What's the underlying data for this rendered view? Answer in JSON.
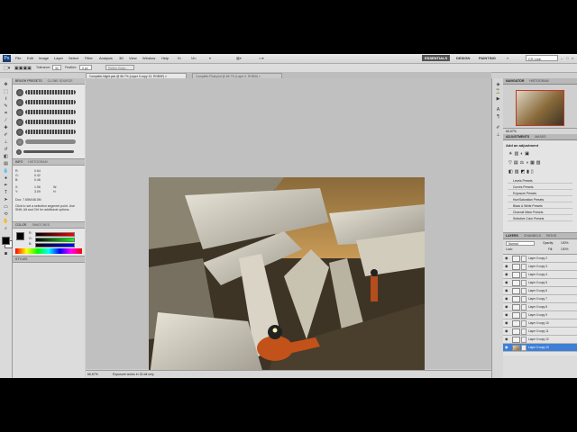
{
  "app": {
    "logo": "Ps"
  },
  "menubar": {
    "items": [
      "File",
      "Edit",
      "Image",
      "Layer",
      "Select",
      "Filter",
      "Analysis",
      "3D",
      "View",
      "Window",
      "Help"
    ],
    "workspaces": [
      "ESSENTIALS",
      "DESIGN",
      "PAINTING"
    ],
    "more": "»",
    "search_placeholder": "CS Live"
  },
  "options": {
    "tolerance_label": "Tolerance:",
    "tolerance_value": "32",
    "feather_label": "Feather:",
    "feather_value": "0 px",
    "refine_label": "Refine Edge..."
  },
  "tabs": [
    {
      "label": "Complete-Night.psd @ 66.7% (Layer 0 copy 13, RGB/8*) ×",
      "active": true
    },
    {
      "label": "Complete-Final.psd @ 66.7% (Layer 0, RGB/8) ×",
      "active": false
    }
  ],
  "brushes_panel": {
    "tab1": "BRUSH PRESETS",
    "tab2": "CLONE SOURCE",
    "info_tab": "INFO",
    "navigator_tab": "HISTOGRAM",
    "r_label": "R:",
    "g_label": "G:",
    "b_label": "B:",
    "x_label": "X:",
    "y_label": "Y:",
    "w_label": "W:",
    "h_label": "H:",
    "r_val": "0.64",
    "g_val": "0.42",
    "b_val": "0.46",
    "x_val": "1.96",
    "y_val": "3.09",
    "doc_info": "Doc: 7.65M/48.0M",
    "hint": "Click to set a selection segment point. Use Shift, Alt and Ctrl for additional options.",
    "color_tab": "COLOR",
    "swatches_tab": "SWATCHES",
    "styles_tab": "STYLES"
  },
  "status": {
    "zoom": "66.67%",
    "info": "Exposure works in 32-bit only"
  },
  "navigator": {
    "tab": "NAVIGATOR",
    "histogram": "HISTOGRAM",
    "zoom": "66.67%"
  },
  "adjustments": {
    "tab": "ADJUSTMENTS",
    "masks": "MASKS",
    "title": "Add an adjustment",
    "presets": [
      "Levels Presets",
      "Curves Presets",
      "Exposure Presets",
      "Hue/Saturation Presets",
      "Black & White Presets",
      "Channel Mixer Presets",
      "Selective Color Presets"
    ]
  },
  "layers": {
    "tab": "LAYERS",
    "channels": "CHANNELS",
    "paths": "PATHS",
    "blend_mode": "Normal",
    "opacity_label": "Opacity:",
    "opacity_value": "100%",
    "lock_label": "Lock:",
    "fill_label": "Fill:",
    "fill_value": "100%",
    "items": [
      "Layer 0 copy 2",
      "Layer 0 copy 3",
      "Layer 0 copy 4",
      "Layer 0 copy 5",
      "Layer 0 copy 6",
      "Layer 0 copy 7",
      "Layer 0 copy 8",
      "Layer 0 copy 9",
      "Layer 0 copy 10",
      "Layer 0 copy 11",
      "Layer 0 copy 12",
      "Layer 0 copy 13"
    ]
  },
  "colors": {
    "fg": "#000000",
    "bg": "#ffffff",
    "accent": "#3d7fd8"
  }
}
